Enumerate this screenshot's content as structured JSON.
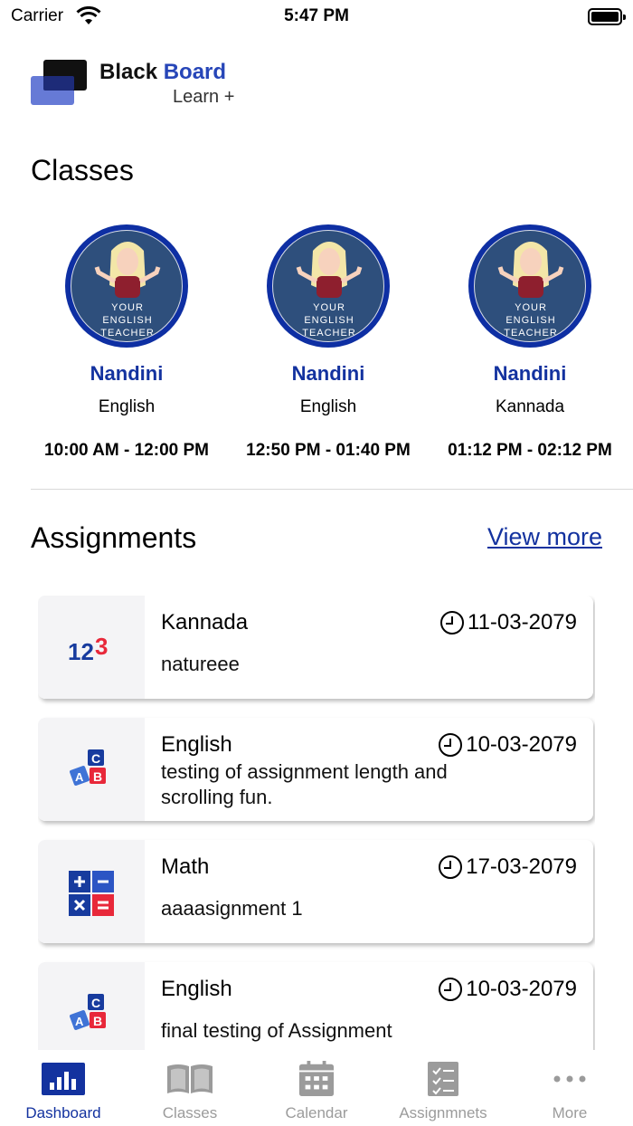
{
  "status_bar": {
    "carrier": "Carrier",
    "time": "5:47 PM"
  },
  "logo": {
    "word1": "Black",
    "word2": "Board",
    "sub": "Learn +"
  },
  "classes": {
    "title": "Classes",
    "avatar_caption": [
      "YOUR",
      "ENGLISH",
      "TEACHER"
    ],
    "items": [
      {
        "teacher": "Nandini",
        "subject": "English",
        "time": "10:00 AM - 12:00 PM"
      },
      {
        "teacher": "Nandini",
        "subject": "English",
        "time": "12:50 PM - 01:40 PM"
      },
      {
        "teacher": "Nandini",
        "subject": "Kannada",
        "time": "01:12 PM - 02:12 PM"
      }
    ]
  },
  "assignments": {
    "title": "Assignments",
    "view_more": "View more",
    "items": [
      {
        "subject": "Kannada",
        "date": "11-03-2079",
        "description": "natureee",
        "icon": "numbers-123-icon"
      },
      {
        "subject": "English",
        "date": "10-03-2079",
        "description": "testing of assignment length and scrolling fun.",
        "icon": "abc-blocks-icon"
      },
      {
        "subject": "Math",
        "date": "17-03-2079",
        "description": "aaaasignment 1",
        "icon": "calculator-icon"
      },
      {
        "subject": "English",
        "date": "10-03-2079",
        "description": "final testing of Assignment",
        "icon": "abc-blocks-icon"
      }
    ]
  },
  "tabs": [
    {
      "label": "Dashboard",
      "icon": "dashboard-icon",
      "active": true
    },
    {
      "label": "Classes",
      "icon": "book-icon",
      "active": false
    },
    {
      "label": "Calendar",
      "icon": "calendar-icon",
      "active": false
    },
    {
      "label": "Assignmnets",
      "icon": "checklist-icon",
      "active": false
    },
    {
      "label": "More",
      "icon": "more-dots-icon",
      "active": false
    }
  ],
  "colors": {
    "accent": "#13329f",
    "inactive_tab": "#9b9b9b",
    "avatar_ring": "#0e2fa3"
  }
}
